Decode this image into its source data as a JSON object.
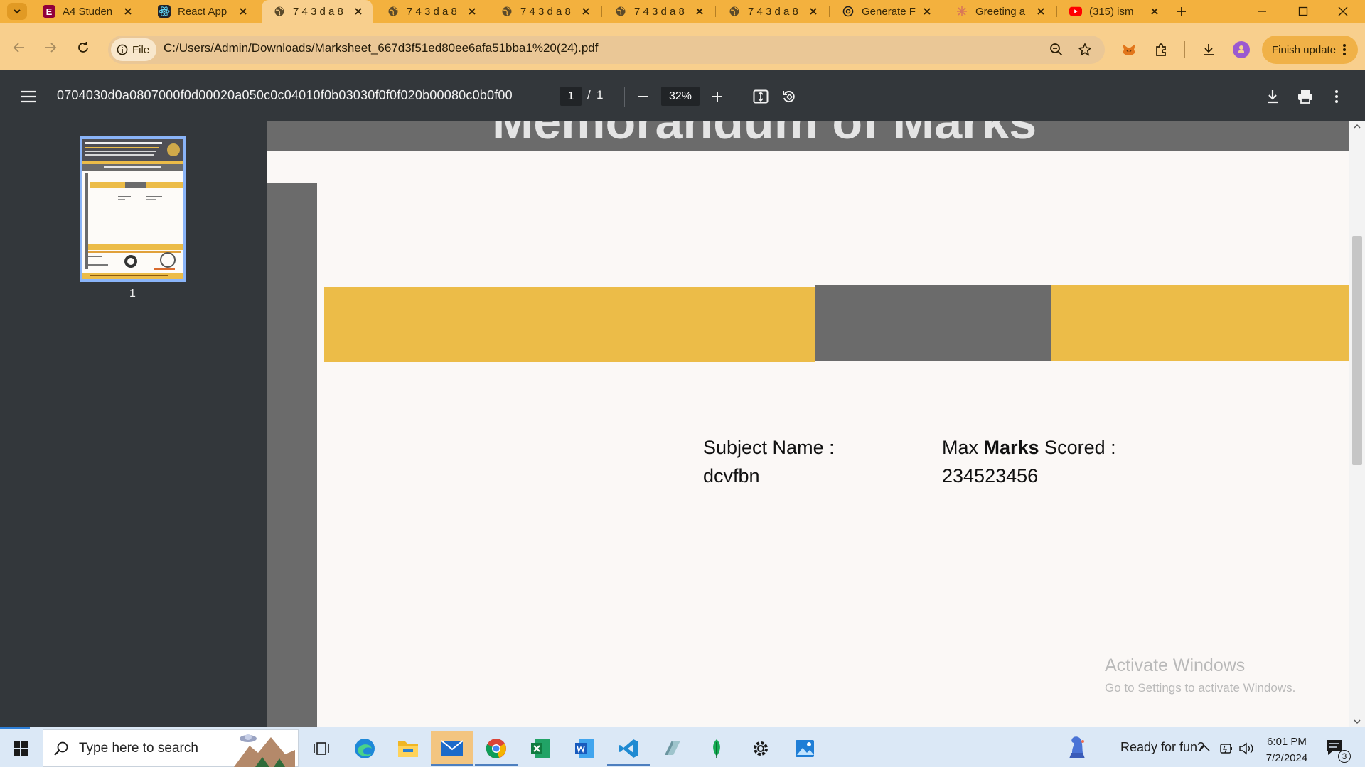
{
  "browser": {
    "tabs": [
      {
        "title": "A4 Studen",
        "icon": "elementor-icon",
        "color": "#92003b"
      },
      {
        "title": "React App",
        "icon": "react-icon",
        "color": "#2a2a2a"
      },
      {
        "title": "7 4 3 d a 8",
        "icon": "globe-icon",
        "active": true
      },
      {
        "title": "7 4 3 d a 8",
        "icon": "globe-icon"
      },
      {
        "title": "7 4 3 d a 8",
        "icon": "globe-icon"
      },
      {
        "title": "7 4 3 d a 8",
        "icon": "globe-icon"
      },
      {
        "title": "7 4 3 d a 8",
        "icon": "globe-icon"
      },
      {
        "title": "Generate F",
        "icon": "openai-icon"
      },
      {
        "title": "Greeting a",
        "icon": "claude-icon",
        "color": "#d97757"
      },
      {
        "title": "(315) ism",
        "icon": "youtube-icon",
        "color": "#ff0000"
      }
    ],
    "chip_label": "File",
    "url": "C:/Users/Admin/Downloads/Marksheet_667d3f51ed80ee6afa51bba1%20(24).pdf",
    "finish_update_label": "Finish update"
  },
  "pdf_viewer": {
    "doc_title": "0704030d0a0807000f0d00020a050c0c04010f0b03030f0f0f020b00080c0b0f00",
    "page_current": "1",
    "page_sep": "/",
    "page_total": "1",
    "zoom": "32%",
    "thumbnail_page_label": "1"
  },
  "document": {
    "subject_name_label": "Subject Name :",
    "subject_name_value": "dcvfbn",
    "max_marks_label_prefix": "Max ",
    "max_marks_label_bold": "Marks",
    "max_marks_label_suffix": " Scored :",
    "max_marks_value": "234523456",
    "watermark_title": "Activate Windows",
    "watermark_subtitle": "Go to Settings to activate Windows."
  },
  "taskbar": {
    "search_placeholder": "Type here to search",
    "widget_text": "Ready for fun?",
    "time": "6:01 PM",
    "date": "7/2/2024",
    "notification_count": "3"
  },
  "colors": {
    "tab_strip": "#f3b13e",
    "toolbar": "#f8cf8d",
    "pdf_toolbar": "#33373b",
    "doc_yellow": "#ecbc48",
    "doc_gray": "#6b6b6b"
  }
}
